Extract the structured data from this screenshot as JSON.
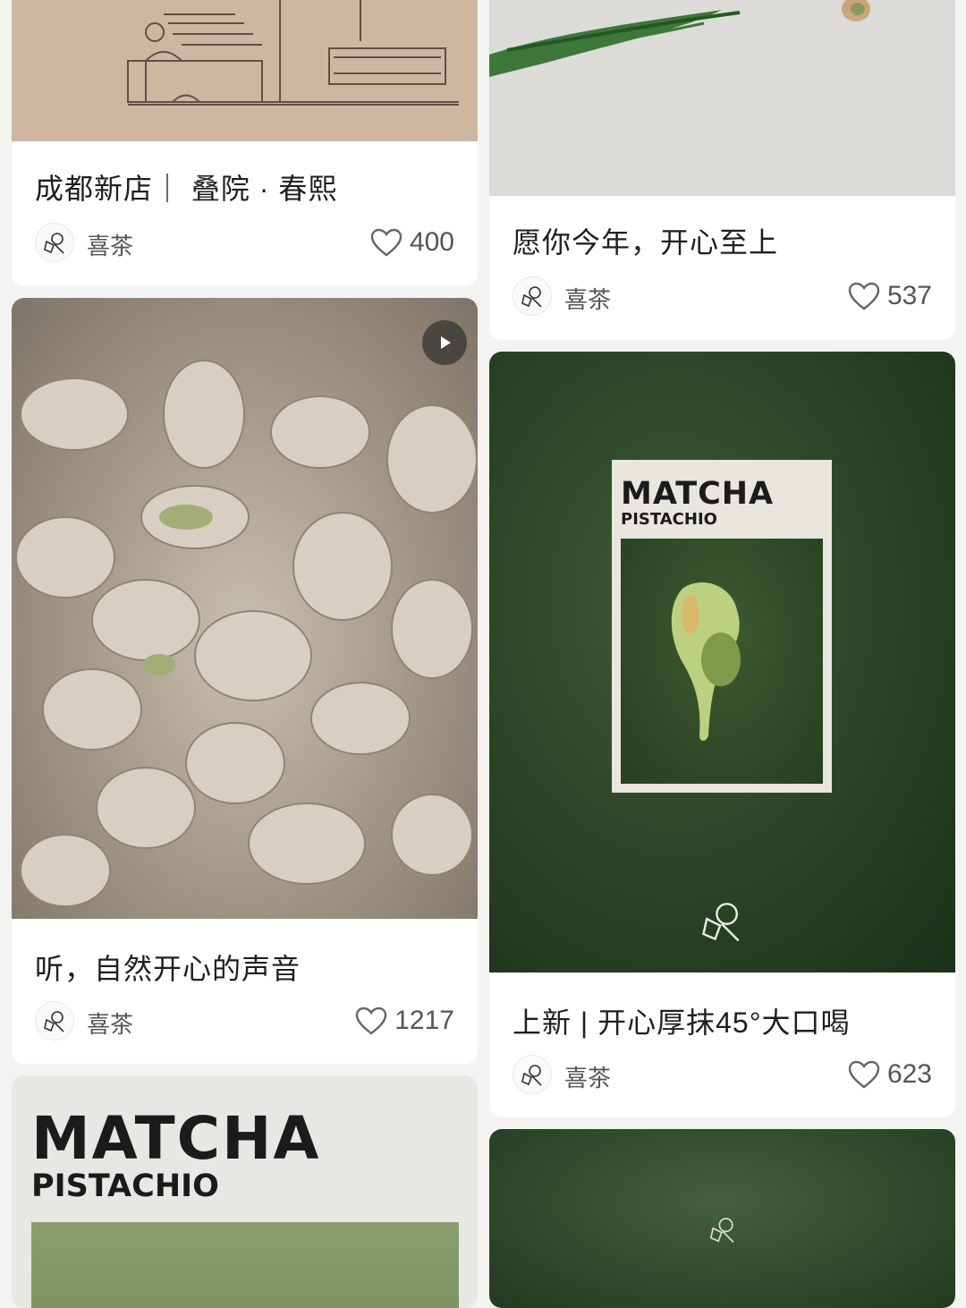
{
  "feed": {
    "cards": [
      {
        "title": "成都新店｜ 叠院 · 春熙",
        "author": "喜茶",
        "likes": "400"
      },
      {
        "title": "愿你今年，开心至上",
        "author": "喜茶",
        "likes": "537"
      },
      {
        "title": "听，自然开心的声音",
        "author": "喜茶",
        "likes": "1217"
      },
      {
        "title": "上新 | 开心厚抹45°大口喝",
        "author": "喜茶",
        "likes": "623"
      }
    ],
    "poster": {
      "big": "MATCHA",
      "small": "PISTACHIO"
    },
    "poster2": {
      "big": "MATCHA",
      "small": "PISTACHIO"
    }
  },
  "colors": {
    "background": "#f3f3f1",
    "card": "#ffffff",
    "text": "#1f1f1f",
    "meta": "#555555"
  }
}
